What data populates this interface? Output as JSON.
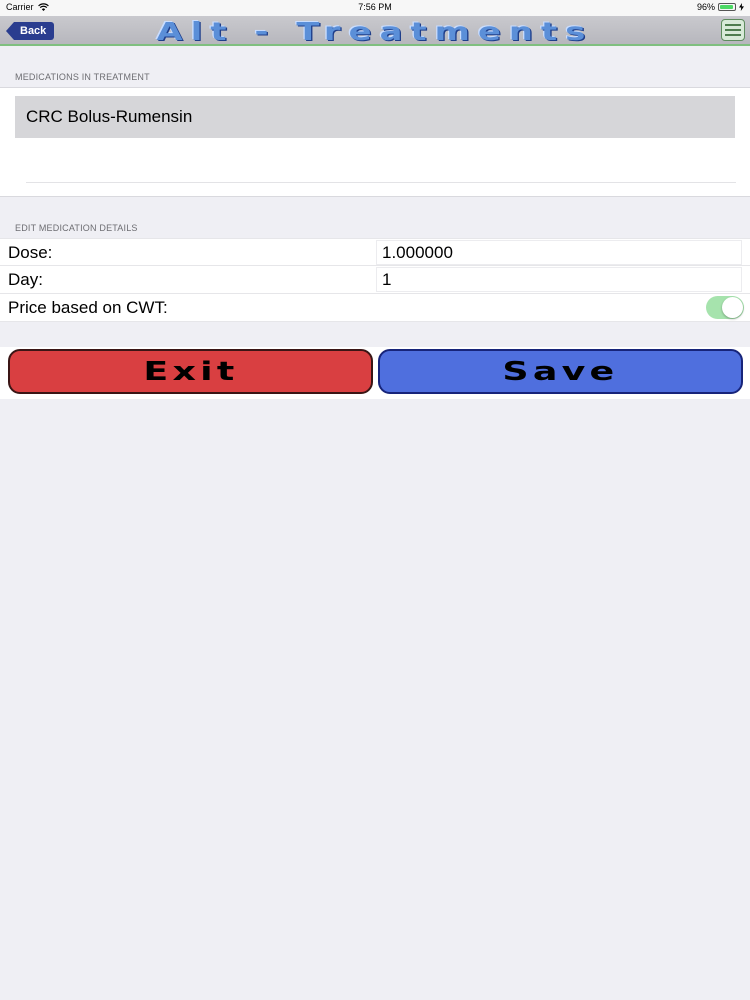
{
  "status_bar": {
    "carrier": "Carrier",
    "time": "7:56 PM",
    "battery_text": "96%",
    "battery_level": 0.96,
    "wifi_icon": "wifi-icon",
    "charging_icon": "charging-icon"
  },
  "nav": {
    "back_label": "Back",
    "title": "Alt - Treatments",
    "menu_icon": "menu-icon"
  },
  "medications_section": {
    "header": "MEDICATIONS IN TREATMENT",
    "items": [
      {
        "label": "CRC Bolus-Rumensin",
        "selected": true
      }
    ]
  },
  "details_section": {
    "header": "EDIT MEDICATION DETAILS",
    "dose": {
      "label": "Dose:",
      "value": "1.000000"
    },
    "day": {
      "label": "Day:",
      "value": "1"
    },
    "price_cwt": {
      "label": "Price based on CWT:",
      "enabled": true
    }
  },
  "actions": {
    "exit_label": "Exit",
    "save_label": "Save"
  },
  "colors": {
    "background": "#efeff4",
    "exit": "#d93f41",
    "save": "#4f6fde",
    "toggle_on": "#a6e3ad",
    "title_blue": "#5b8fd8",
    "back_blue": "#2a3d8f"
  }
}
